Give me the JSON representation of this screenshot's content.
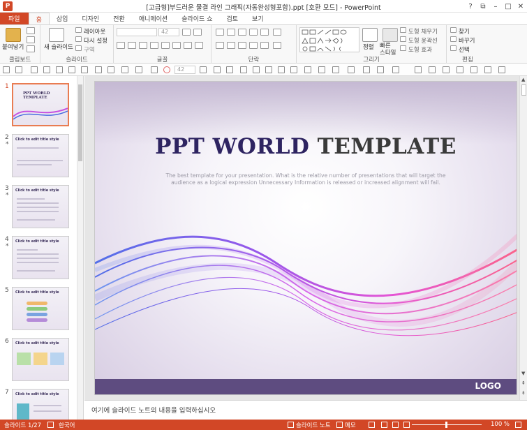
{
  "window": {
    "title": "[고급형]부드러운 물결 라인 그래픽(자동완성형포함).ppt [호환 모드] - PowerPoint",
    "controls": [
      "?",
      "⧉",
      "–",
      "□",
      "✕"
    ]
  },
  "tabs": [
    {
      "label": "파일"
    },
    {
      "label": "홈"
    },
    {
      "label": "삽입"
    },
    {
      "label": "디자인"
    },
    {
      "label": "전환"
    },
    {
      "label": "애니메이션"
    },
    {
      "label": "슬라이드 쇼"
    },
    {
      "label": "검토"
    },
    {
      "label": "보기"
    }
  ],
  "ribbon": {
    "clipboard": {
      "label": "클립보드",
      "paste": "붙여넣기"
    },
    "slides": {
      "label": "슬라이드",
      "new_slide": "새 슬라이드",
      "layout": "레이아웃",
      "reset": "다시 설정",
      "section": "구역"
    },
    "font": {
      "label": "글꼴",
      "size": "42"
    },
    "paragraph": {
      "label": "단락"
    },
    "drawing": {
      "label": "그리기",
      "arrange": "정렬",
      "quick_styles": "빠른\n스타일",
      "fill": "도형 채우기",
      "outline": "도형 윤곽선",
      "effects": "도형 효과"
    },
    "editing": {
      "label": "편집",
      "find": "찾기",
      "replace": "바꾸기",
      "select": "선택"
    }
  },
  "quick_toolbar": {
    "font_size": "42"
  },
  "thumbnails": [
    {
      "num": "1",
      "title": "PPT WORLD TEMPLATE",
      "star": ""
    },
    {
      "num": "2",
      "title": "Click to edit title style",
      "star": "*"
    },
    {
      "num": "3",
      "title": "Click to edit title style",
      "star": "*"
    },
    {
      "num": "4",
      "title": "Click to edit title style",
      "star": "*"
    },
    {
      "num": "5",
      "title": "Click to edit title style",
      "star": ""
    },
    {
      "num": "6",
      "title": "Click to edit title style",
      "star": ""
    },
    {
      "num": "7",
      "title": "Click to edit title style",
      "star": ""
    }
  ],
  "slide": {
    "title_part1": "PPT WORLD ",
    "title_part2": "TEMPLATE",
    "subtitle": "The best template for your presentation. What is the relative number of presentations that will target the audience as a logical expression Unnecessary Information is released or increased alignment will fail.",
    "logo": "LOGO"
  },
  "notes": {
    "placeholder": "여기에 슬라이드 노트의 내용을 입력하십시오"
  },
  "status": {
    "slide_count": "슬라이드 1/27",
    "language": "한국어",
    "notes": "슬라이드 노트",
    "comments": "메모",
    "zoom": "100 %"
  },
  "colors": {
    "accent": "#d24726",
    "slide_footer": "#5e4c80",
    "title_dark": "#2e2461"
  }
}
